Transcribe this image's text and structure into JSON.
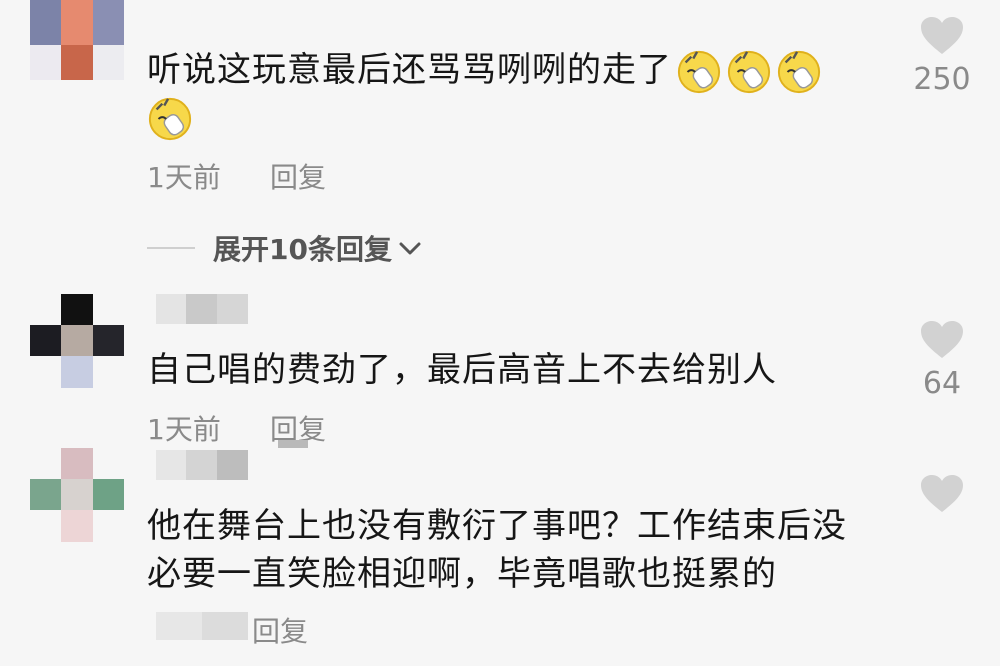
{
  "comments": [
    {
      "text_line1": "听说这玩意最后还骂骂咧咧的走了",
      "emoji_count": 4,
      "emoji_icon": "yawn-emoji-icon",
      "time": "1天前",
      "reply": "回复",
      "likes": "250",
      "expand_label": "展开10条回复"
    },
    {
      "text_line1": "自己唱的费劲了，最后高音上不去给别人",
      "time": "1天前",
      "reply": "回复",
      "likes": "64"
    },
    {
      "text_line1": "他在舞台上也没有敷衍了事吧？工作结束后没",
      "text_line2": "必要一直笑脸相迎啊，毕竟唱歌也挺累的",
      "reply": "回复",
      "likes": ""
    }
  ],
  "colors": {
    "background": "#f6f6f6",
    "text": "#161616",
    "meta": "#8a8a8a",
    "heart": "#d2d2d2"
  }
}
